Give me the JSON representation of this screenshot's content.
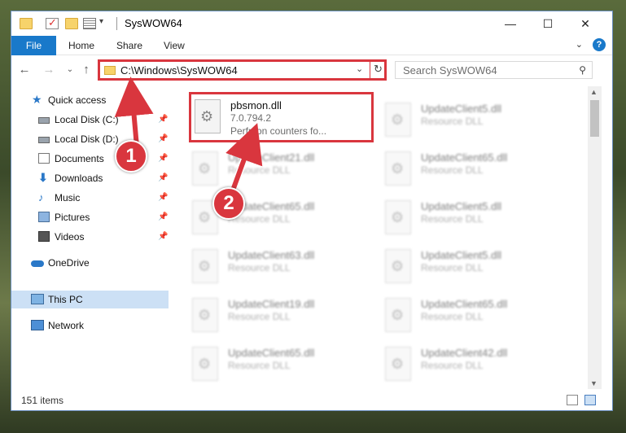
{
  "window": {
    "title": "SysWOW64"
  },
  "ribbon": {
    "tabs": [
      "File",
      "Home",
      "Share",
      "View"
    ],
    "help": "?"
  },
  "nav": {
    "address": "C:\\Windows\\SysWOW64",
    "search_placeholder": "Search SysWOW64"
  },
  "sidebar": {
    "quick_access": "Quick access",
    "items": [
      {
        "label": "Local Disk (C:)",
        "icon": "disk-icon"
      },
      {
        "label": "Local Disk (D:)",
        "icon": "disk-icon"
      },
      {
        "label": "Documents",
        "icon": "documents-icon"
      },
      {
        "label": "Downloads",
        "icon": "downloads-icon"
      },
      {
        "label": "Music",
        "icon": "music-icon"
      },
      {
        "label": "Pictures",
        "icon": "pictures-icon"
      },
      {
        "label": "Videos",
        "icon": "videos-icon"
      }
    ],
    "onedrive": "OneDrive",
    "this_pc": "This PC",
    "network": "Network"
  },
  "files": {
    "highlighted": {
      "name": "pbsmon.dll",
      "version": "7.0.794.2",
      "description": "Perfmon counters fo..."
    },
    "left_column": [
      {
        "name": "UpdateClient21.dll",
        "description": "Resource DLL"
      },
      {
        "name": "UpdateClient65.dll",
        "description": "Resource DLL"
      },
      {
        "name": "UpdateClient63.dll",
        "description": "Resource DLL"
      },
      {
        "name": "UpdateClient19.dll",
        "description": "Resource DLL"
      },
      {
        "name": "UpdateClient65.dll",
        "description": "Resource DLL"
      }
    ],
    "right_column": [
      {
        "name": "UpdateClient5.dll",
        "description": "Resource DLL"
      },
      {
        "name": "UpdateClient65.dll",
        "description": "Resource DLL"
      },
      {
        "name": "UpdateClient5.dll",
        "description": "Resource DLL"
      },
      {
        "name": "UpdateClient5.dll",
        "description": "Resource DLL"
      },
      {
        "name": "UpdateClient65.dll",
        "description": "Resource DLL"
      },
      {
        "name": "UpdateClient42.dll",
        "description": "Resource DLL"
      }
    ]
  },
  "status": {
    "item_count": "151 items"
  },
  "callouts": [
    "1",
    "2"
  ],
  "colors": {
    "accent": "#1979ca",
    "highlight": "#d9363e",
    "selected": "#cce0f5"
  }
}
